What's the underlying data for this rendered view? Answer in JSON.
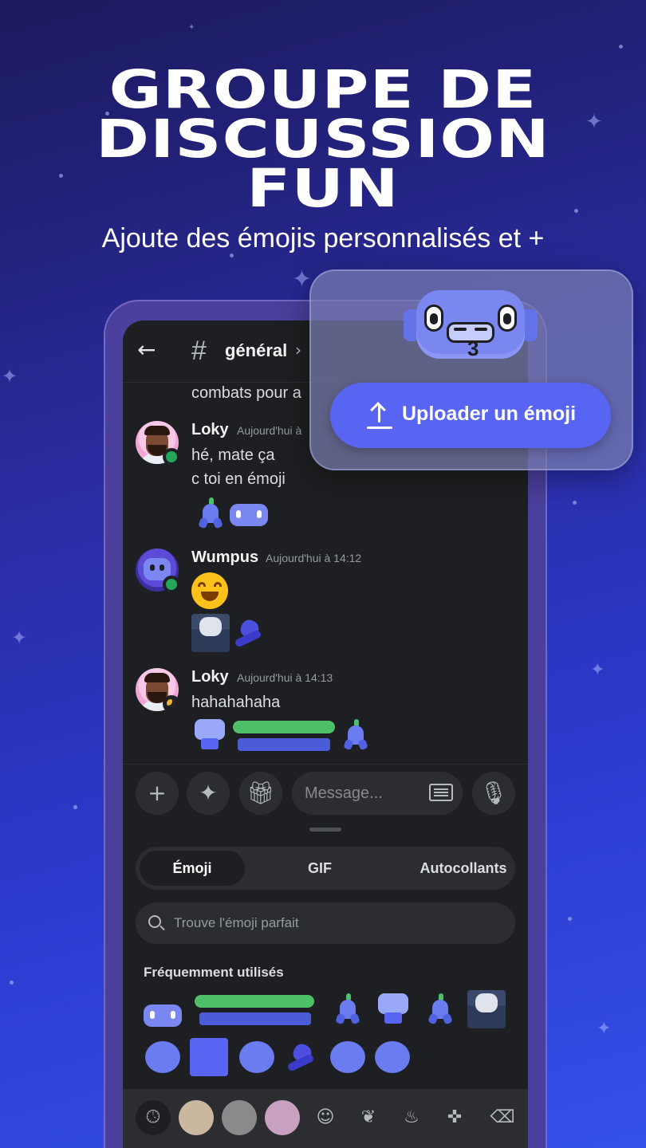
{
  "headline": {
    "line1": "GROUPE DE",
    "line2": "DISCUSSION",
    "line3": "FUN"
  },
  "subtitle": "Ajoute des émojis personnalisés et +",
  "upload_card": {
    "button_label": "Uploader un émoji",
    "emoji_icon": "robot-face-icon",
    "button_icon": "upload-icon"
  },
  "chat": {
    "back_icon": "arrow-left-icon",
    "channel_hash": "#",
    "channel_name": "général",
    "channel_chevron": "›",
    "clipped_line": "combats pour a",
    "messages": [
      {
        "author": "Loky",
        "time": "Aujourd'hui à",
        "lines": [
          "hé, mate ça",
          "c toi en émoji"
        ],
        "status": "online"
      },
      {
        "author": "Wumpus",
        "time": "Aujourd'hui à 14:12",
        "lines": [],
        "status": "online"
      },
      {
        "author": "Loky",
        "time": "Aujourd'hui à 14:13",
        "lines": [
          "hahahahaha"
        ],
        "status": "idle"
      }
    ]
  },
  "composer": {
    "plus_icon": "+",
    "apps_icon": "apps-icon",
    "gift_icon": "gift-icon",
    "placeholder": "Message...",
    "keyboard_icon": "keyboard-icon",
    "mic_icon": "microphone-icon"
  },
  "picker": {
    "tabs": [
      "Émoji",
      "GIF",
      "Autocollants"
    ],
    "active_tab": "Émoji",
    "search_placeholder": "Trouve l'émoji parfait",
    "section_title": "Fréquemment utilisés"
  },
  "categories": [
    "clock-icon",
    "cat-avatar",
    "server-avatar-2",
    "server-avatar-3",
    "smiley-icon",
    "leaf-icon",
    "food-bowl-icon",
    "gamepad-icon",
    "backspace-icon"
  ],
  "colors": {
    "accent": "#5865f2",
    "online": "#23a55a",
    "idle": "#f0b232",
    "background_dark": "#1e1f22"
  }
}
